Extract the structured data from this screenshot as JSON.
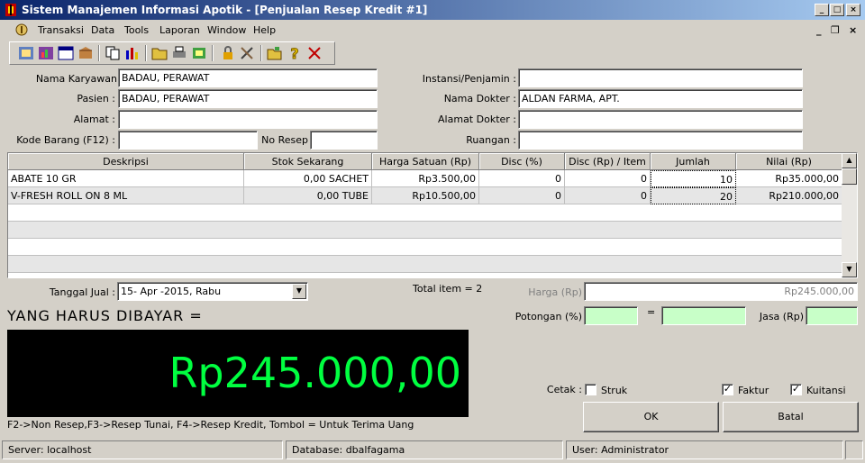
{
  "window": {
    "title": "Sistem Manajemen Informasi Apotik - [Penjualan Resep Kredit #1]"
  },
  "menu": {
    "items": [
      "Transaksi",
      "Data",
      "Tools",
      "Laporan",
      "Window",
      "Help"
    ]
  },
  "form": {
    "nama_karyawan_label": "Nama Karyawan",
    "nama_karyawan_value": "BADAU, PERAWAT",
    "pasien_label": "Pasien :",
    "pasien_value": "BADAU, PERAWAT",
    "alamat_label": "Alamat :",
    "alamat_value": "",
    "kode_barang_label": "Kode Barang (F12) :",
    "kode_barang_value": "",
    "no_resep_label": "No Resep",
    "no_resep_value": "",
    "instansi_label": "Instansi/Penjamin :",
    "instansi_value": "",
    "nama_dokter_label": "Nama Dokter :",
    "nama_dokter_value": "ALDAN FARMA, APT.",
    "alamat_dokter_label": "Alamat Dokter :",
    "alamat_dokter_value": "",
    "ruangan_label": "Ruangan :",
    "ruangan_value": ""
  },
  "table": {
    "headers": [
      "Deskripsi",
      "Stok Sekarang",
      "Harga Satuan (Rp)",
      "Disc (%)",
      "Disc (Rp) / Item",
      "Jumlah",
      "Nilai (Rp)"
    ],
    "rows": [
      [
        "ABATE 10 GR",
        "0,00 SACHET",
        "Rp3.500,00",
        "0",
        "0",
        "10",
        "Rp35.000,00"
      ],
      [
        "V-FRESH ROLL ON 8 ML",
        "0,00 TUBE",
        "Rp10.500,00",
        "0",
        "0",
        "20",
        "Rp210.000,00"
      ]
    ]
  },
  "footer": {
    "tanggal_label": "Tanggal Jual :",
    "tanggal_value": "15- Apr -2015,  Rabu",
    "total_item": "Total item = 2",
    "harga_label": "Harga (Rp)",
    "harga_value": "Rp245.000,00",
    "potongan_label": "Potongan (%)",
    "equals": "=",
    "jasa_label": "Jasa (Rp)",
    "bayar_label": "YANG HARUS DIBAYAR =",
    "bayar_value": "Rp245.000,00",
    "hint": "F2->Non Resep,F3->Resep Tunai, F4->Resep Kredit, Tombol = Untuk Terima Uang",
    "cetak_label": "Cetak :",
    "struk_label": "Struk",
    "faktur_label": "Faktur",
    "kuitansi_label": "Kuitansi",
    "ok_label": "OK",
    "batal_label": "Batal"
  },
  "checks": {
    "struk": false,
    "faktur": true,
    "kuitansi": true
  },
  "status": {
    "server": "Server:  localhost",
    "database": "Database:  dbalfagama",
    "user": "User:  Administrator"
  }
}
